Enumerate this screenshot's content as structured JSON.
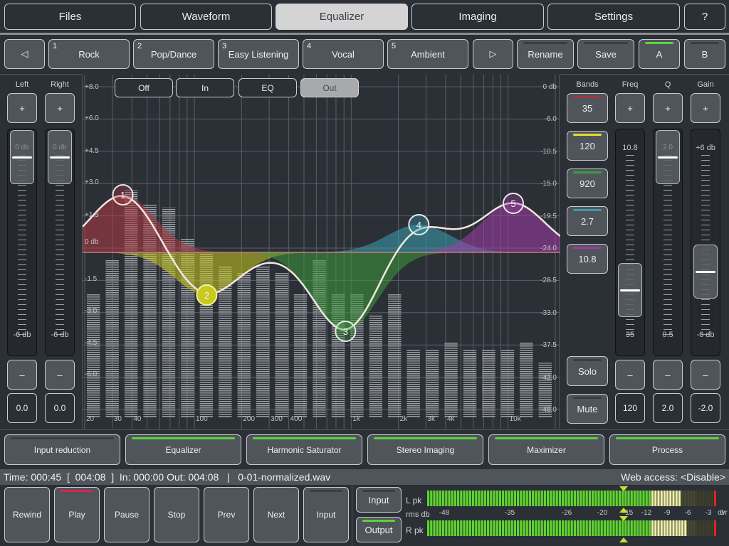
{
  "main_tabs": [
    {
      "label": "Files",
      "selected": false
    },
    {
      "label": "Waveform",
      "selected": false
    },
    {
      "label": "Equalizer",
      "selected": true
    },
    {
      "label": "Imaging",
      "selected": false
    },
    {
      "label": "Settings",
      "selected": false
    },
    {
      "label": "?",
      "selected": false
    }
  ],
  "presets": {
    "prev_icon": "◁",
    "next_icon": "▷",
    "items": [
      {
        "num": "1",
        "label": "Rock"
      },
      {
        "num": "2",
        "label": "Pop/Dance"
      },
      {
        "num": "3",
        "label": "Easy Listening"
      },
      {
        "num": "4",
        "label": "Vocal"
      },
      {
        "num": "5",
        "label": "Ambient"
      }
    ],
    "rename_label": "Rename",
    "save_label": "Save",
    "a_label": "A",
    "b_label": "B",
    "a_active": true,
    "b_active": false
  },
  "input_gain": {
    "left_label": "Left",
    "right_label": "Right",
    "plus": "+",
    "minus": "–",
    "top_scale": "0 db",
    "bottom_scale": "-6 db",
    "left_value": "0.0",
    "right_value": "0.0",
    "left_level": 1.0,
    "right_level": 1.0
  },
  "view_modes": {
    "items": [
      "Off",
      "In",
      "EQ",
      "Out"
    ],
    "selected": "Out"
  },
  "graph": {
    "left_axis": [
      "+8.0",
      "+6.0",
      "+4.5",
      "+3.0",
      "+1.5",
      "0 db",
      "-1.5",
      "-3.0",
      "-4.5",
      "-6.0"
    ],
    "right_axis": [
      "0 db",
      "-6.0",
      "-10.5",
      "-15.0",
      "-19.5",
      "-24.0",
      "-28.5",
      "-33.0",
      "-37.5",
      "-42.0",
      "-48.0"
    ],
    "freq_labels": [
      "20",
      "30",
      "40",
      "100",
      "200",
      "300",
      "400",
      "1k",
      "2k",
      "3k",
      "4k",
      "10k"
    ],
    "bands": [
      {
        "id": "1",
        "freq_hz": 35,
        "gain_db": 2.7,
        "color": "#b23a44"
      },
      {
        "id": "2",
        "freq_hz": 120,
        "gain_db": -2.0,
        "color": "#c9c91e"
      },
      {
        "id": "3",
        "freq_hz": 920,
        "gain_db": -3.7,
        "color": "#3c9a3a"
      },
      {
        "id": "4",
        "freq_hz": 2700,
        "gain_db": 1.3,
        "color": "#3aa0b0"
      },
      {
        "id": "5",
        "freq_hz": 10800,
        "gain_db": 2.3,
        "color": "#a03ca6"
      }
    ],
    "spectrum_db": [
      -30,
      -25,
      -15,
      -17,
      -17.5,
      -22,
      -24,
      -26,
      -27,
      -26,
      -27,
      -30,
      -25,
      -30,
      -30,
      -33,
      -30,
      -38,
      -38,
      -37,
      -38,
      -38,
      -38,
      -37,
      -40
    ]
  },
  "bands_panel": {
    "bands_label": "Bands",
    "freq_label": "Freq",
    "q_label": "Q",
    "gain_label": "Gain",
    "band_buttons": [
      {
        "label": "35",
        "color": "#9a3b45"
      },
      {
        "label": "120",
        "color": "#e4e02c"
      },
      {
        "label": "920",
        "color": "#3f9a44"
      },
      {
        "label": "2.7",
        "color": "#3e9aa6"
      },
      {
        "label": "10.8",
        "color": "#9a3ea0"
      }
    ],
    "solo_label": "Solo",
    "mute_label": "Mute",
    "freq_top": "10.8",
    "freq_bottom": "35",
    "q_top": "2.0",
    "q_bottom": "0.5",
    "gain_top": "+6 db",
    "gain_bottom": "-6 db",
    "freq_value": "120",
    "q_value": "2.0",
    "gain_value": "-2.0",
    "freq_level": 0.22,
    "q_level": 1.0,
    "gain_level": 0.33
  },
  "modules": [
    {
      "label": "Input reduction",
      "active": false
    },
    {
      "label": "Equalizer",
      "active": true
    },
    {
      "label": "Harmonic Saturator",
      "active": true
    },
    {
      "label": "Stereo Imaging",
      "active": true
    },
    {
      "label": "Maximizer",
      "active": true
    },
    {
      "label": "Process",
      "active": true
    }
  ],
  "status": {
    "text": "Time: 000:45  [  004:08  ]  In: 000:00 Out: 004:08   |   0-01-normalized.wav",
    "web_access": "Web access: <Disable>"
  },
  "transport": [
    {
      "label": "Rewind",
      "indicator": "none"
    },
    {
      "label": "Play",
      "indicator": "red"
    },
    {
      "label": "Pause",
      "indicator": "none"
    },
    {
      "label": "Stop",
      "indicator": "none"
    },
    {
      "label": "Prev",
      "indicator": "none"
    },
    {
      "label": "Next",
      "indicator": "none"
    },
    {
      "label": "Input",
      "indicator": "off"
    }
  ],
  "meter": {
    "input_label": "Input",
    "output_label": "Output",
    "output_active": true,
    "l_label": "L pk",
    "r_label": "R pk",
    "rms_label": "rms db",
    "scale": [
      "-48",
      "-35",
      "-26",
      "-20",
      "-15",
      "-12",
      "-9",
      "-6",
      "-3",
      "0",
      "ovr"
    ],
    "left_peak_db": -8,
    "right_peak_db": -7,
    "rms_marker_db": -17
  },
  "colors": {
    "accent_green": "#58d43a",
    "play_red": "#d8244c",
    "curve": "#f2e6e0"
  }
}
